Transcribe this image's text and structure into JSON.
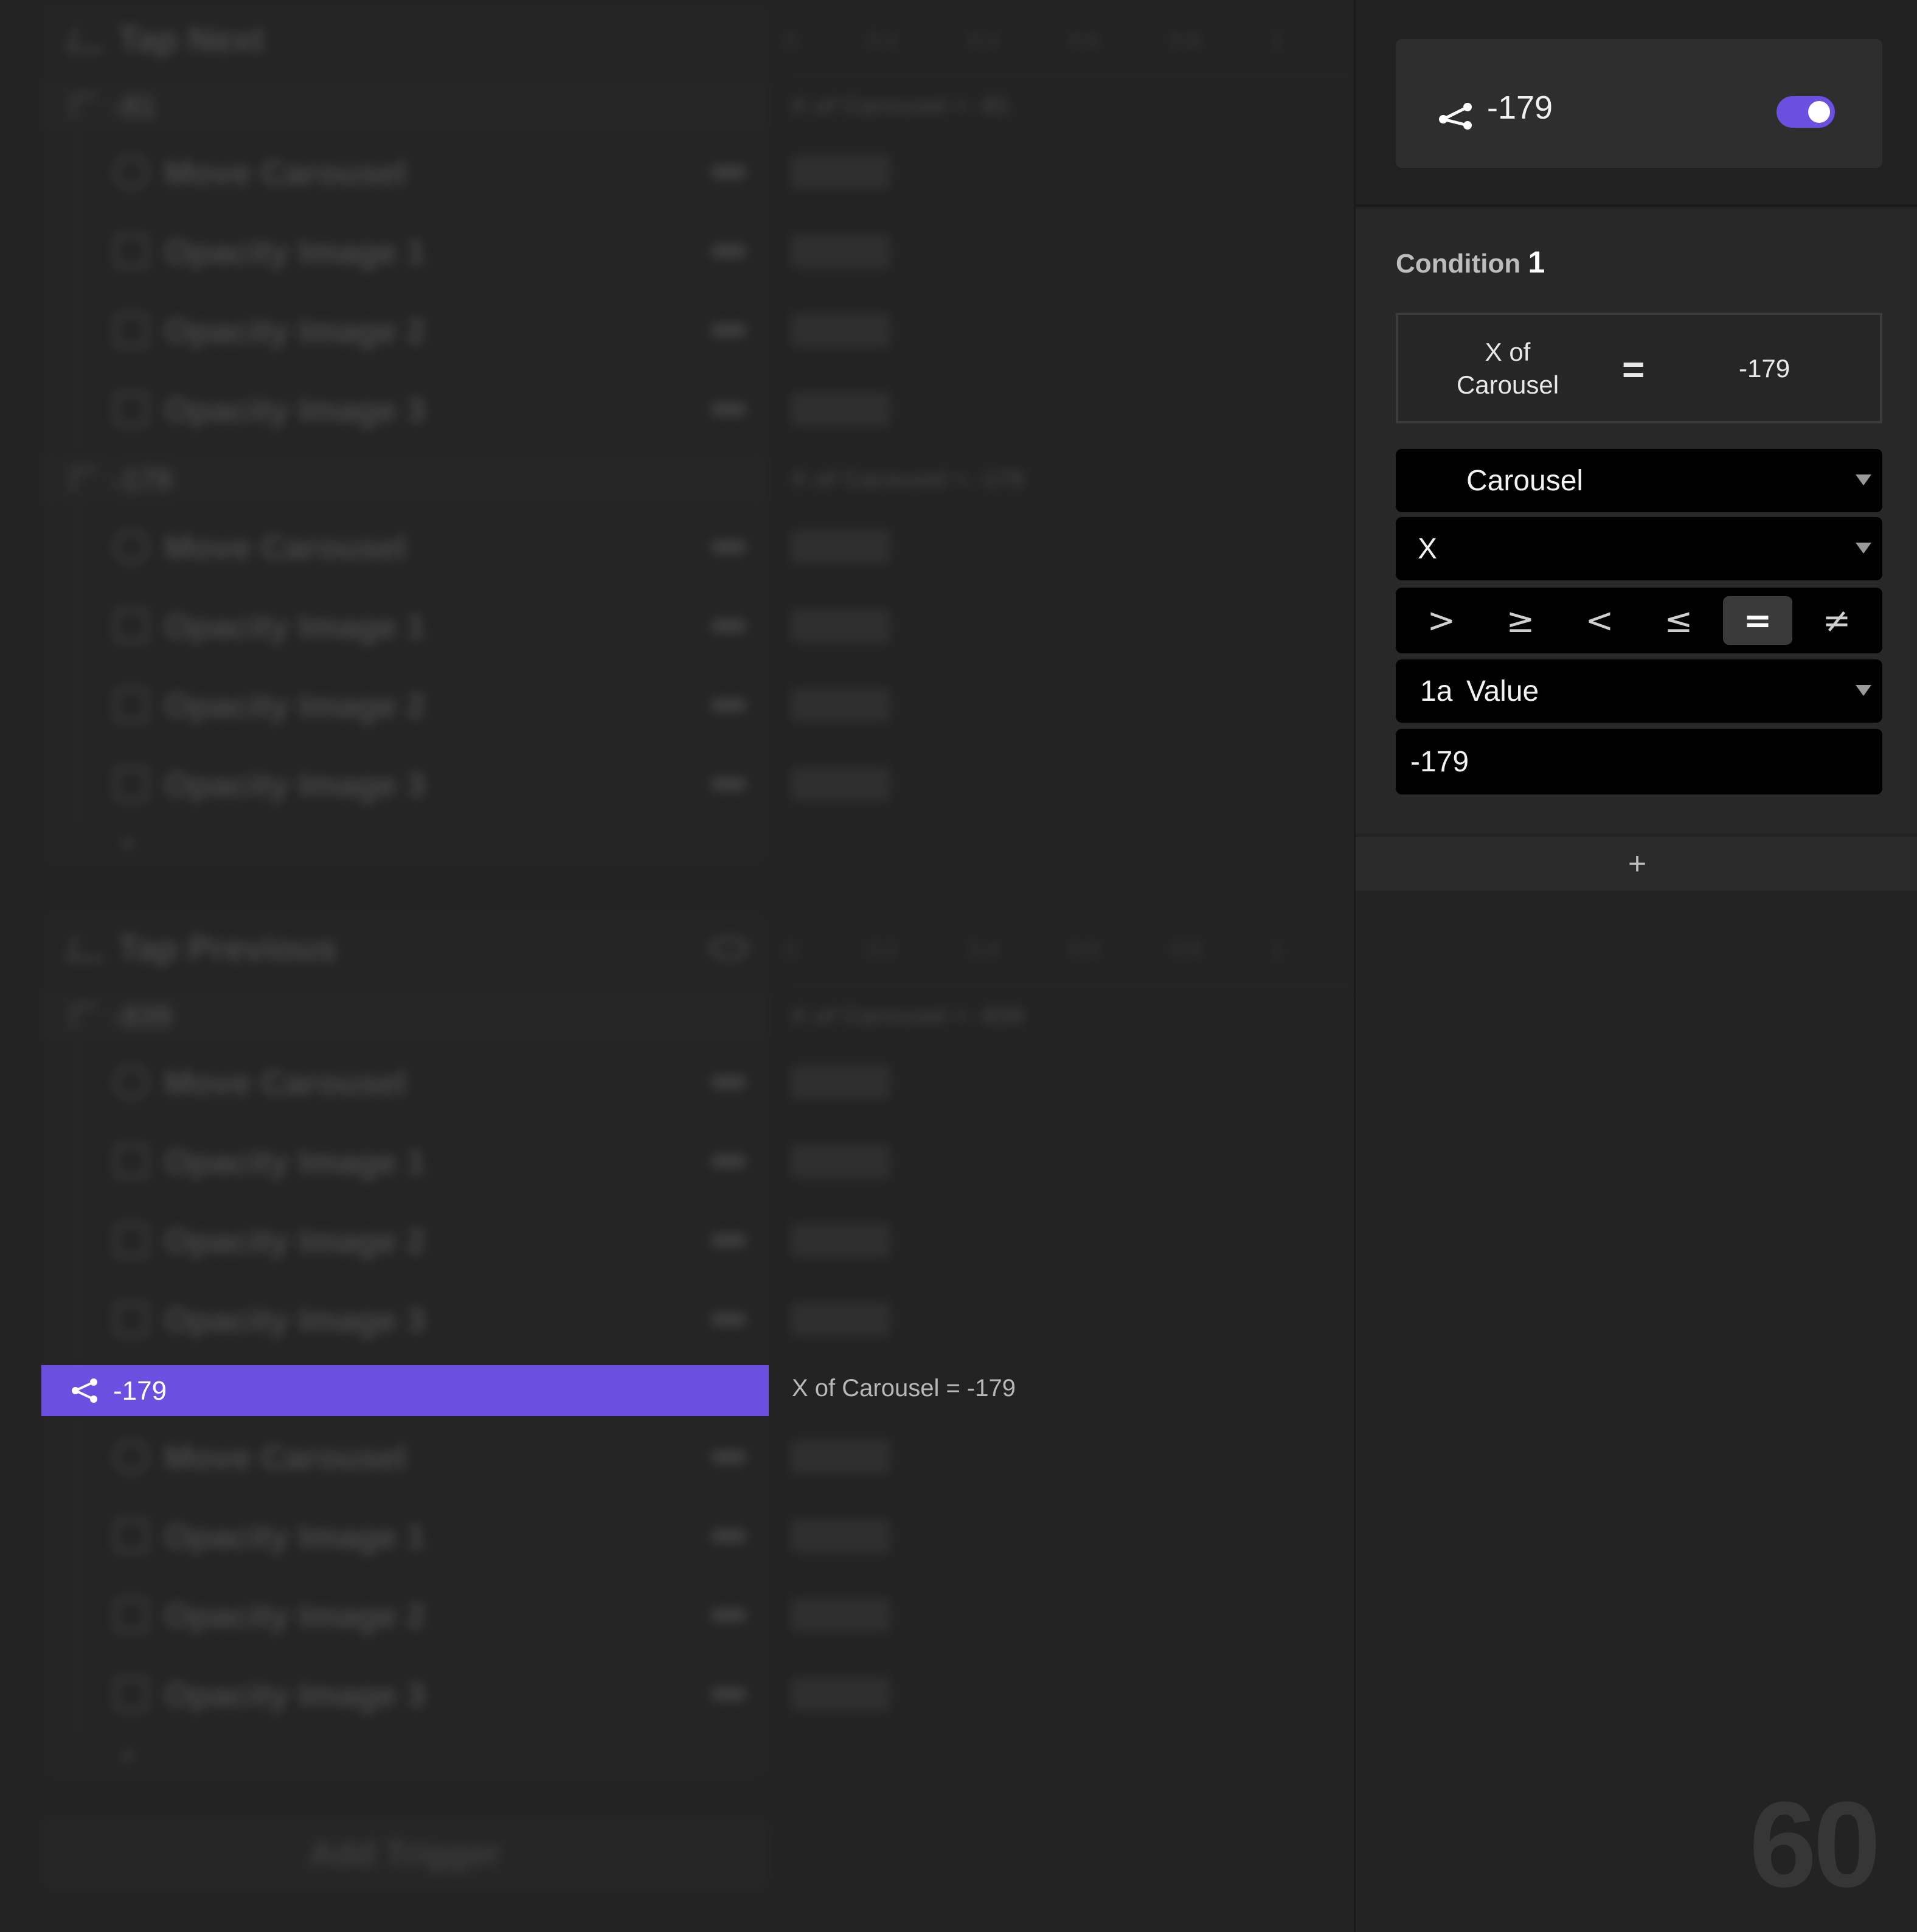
{
  "tree": {
    "groups": [
      {
        "title": "Tap Next",
        "ticks": [
          "0",
          "0.2",
          "0.4",
          "0.6",
          "0.8",
          "1"
        ],
        "states": [
          {
            "label": "-81",
            "condition": "X of Carousel = -81",
            "actions": [
              "Move Carousel",
              "Opacity Image 1",
              "Opacity Image 2",
              "Opacity Image 3"
            ]
          },
          {
            "label": "-179",
            "condition": "X of Carousel = -179",
            "actions": [
              "Move Carousel",
              "Opacity Image 1",
              "Opacity Image 2",
              "Opacity Image 3"
            ]
          }
        ]
      },
      {
        "title": "Tap Previous",
        "ticks": [
          "0",
          "0.2",
          "0.4",
          "0.6",
          "0.8",
          "1"
        ],
        "states": [
          {
            "label": "-839",
            "condition": "X of Carousel = -839",
            "actions": [
              "Move Carousel",
              "Opacity Image 1",
              "Opacity Image 2",
              "Opacity Image 3"
            ]
          },
          {
            "label": "-179",
            "condition": "X of Carousel = -179",
            "actions": [
              "Move Carousel",
              "Opacity Image 1",
              "Opacity Image 2",
              "Opacity Image 3"
            ]
          }
        ]
      }
    ],
    "add_label": "+",
    "add_trigger_label": "Add Trigger"
  },
  "selected": {
    "label": "-179",
    "condition": "X of Carousel = -179"
  },
  "inspector": {
    "trigger_name": "-179",
    "enabled": true,
    "condition_title": "Condition",
    "condition_number": "1",
    "summary": {
      "left": "X of Carousel",
      "op": "=",
      "right": "-179"
    },
    "layer": "Carousel",
    "property": "X",
    "operators": [
      ">",
      "≥",
      "<",
      "≤",
      "=",
      "≠"
    ],
    "active_operator": "=",
    "value_type_icon": "1a",
    "value_type": "Value",
    "value": "-179",
    "add_condition": "+"
  },
  "fps": "60",
  "colors": {
    "accent": "#6a4fe0",
    "panel": "#282828",
    "background": "#232323"
  },
  "icons": {
    "state": "branch-icon",
    "group": "trigger-icon",
    "action_move": "target-icon",
    "action_opacity": "image-icon",
    "visibility": "eye-icon"
  }
}
